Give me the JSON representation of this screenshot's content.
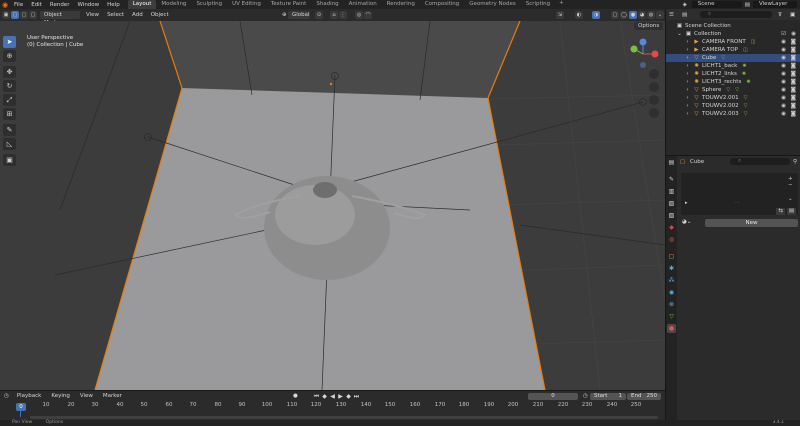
{
  "topbar": {
    "menus": [
      "File",
      "Edit",
      "Render",
      "Window",
      "Help"
    ],
    "workspaces": [
      "Layout",
      "Modeling",
      "Sculpting",
      "UV Editing",
      "Texture Paint",
      "Shading",
      "Animation",
      "Rendering",
      "Compositing",
      "Geometry Nodes",
      "Scripting"
    ],
    "active_workspace": "Layout",
    "scene": "Scene",
    "view_layer": "ViewLayer"
  },
  "viewport_header": {
    "mode": "Object Mode",
    "menus": [
      "View",
      "Select",
      "Add",
      "Object"
    ],
    "orientation": "Global",
    "options": "Options"
  },
  "viewport": {
    "perspective": "User Perspective",
    "collection_info": "(0) Collection | Cube"
  },
  "outliner": {
    "root": "Scene Collection",
    "collection": "Collection",
    "objects": [
      {
        "name": "CAMERA FRONT",
        "icon": "camera-icon",
        "selected": false
      },
      {
        "name": "CAMERA TOP",
        "icon": "camera-icon",
        "selected": false
      },
      {
        "name": "Cube",
        "icon": "mesh-icon",
        "selected": true
      },
      {
        "name": "LICHT1_back",
        "icon": "light-icon",
        "selected": false
      },
      {
        "name": "LICHT2_links",
        "icon": "light-icon",
        "selected": false
      },
      {
        "name": "LICHT3_rechts",
        "icon": "light-icon",
        "selected": false
      },
      {
        "name": "Sphere",
        "icon": "mesh-icon",
        "selected": false
      },
      {
        "name": "TOUWV2.001",
        "icon": "curve-icon",
        "selected": false
      },
      {
        "name": "TOUWV2.002",
        "icon": "curve-icon",
        "selected": false
      },
      {
        "name": "TOUWV2.003",
        "icon": "curve-icon",
        "selected": false
      }
    ]
  },
  "properties": {
    "object_name": "Cube",
    "new_button": "New"
  },
  "timeline": {
    "menus": [
      "Playback",
      "Keying",
      "View",
      "Marker"
    ],
    "current_frame": "0",
    "start_label": "Start",
    "start_value": "1",
    "end_label": "End",
    "end_value": "250",
    "playhead_frame": "0",
    "ruler_ticks": [
      "10",
      "20",
      "30",
      "40",
      "50",
      "60",
      "70",
      "80",
      "90",
      "100",
      "110",
      "120",
      "130",
      "140",
      "150",
      "160",
      "170",
      "180",
      "190",
      "200",
      "210",
      "220",
      "230",
      "240",
      "250"
    ]
  },
  "statusbar": {
    "items": [
      "Pan View",
      "Options"
    ],
    "version": "3.4.1"
  },
  "colors": {
    "accent_blue": "#4772b3",
    "selection_orange": "#e87d0d",
    "grid_bg": "#3c3c3c"
  }
}
